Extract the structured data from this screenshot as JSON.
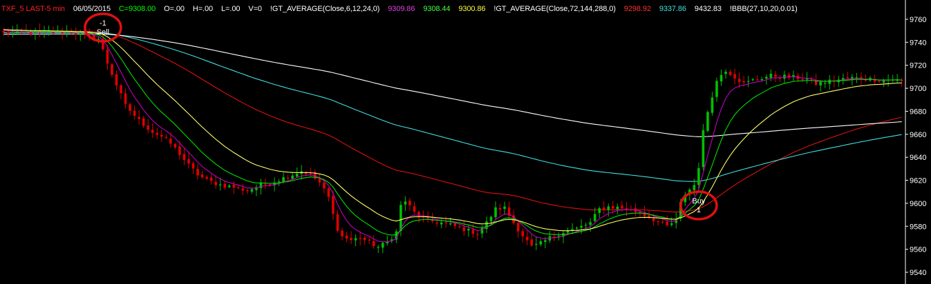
{
  "header": {
    "symbol": "TXF_5 LAST-5 min",
    "date": "06/05/2015",
    "close": "C=9308.00",
    "open": "O=.00",
    "high": "H=.00",
    "low": "L=.00",
    "volume": "V=0",
    "avg1_label": "!GT_AVERAGE(Close,6,12,24,0)",
    "avg1_v1": "9309.86",
    "avg1_v2": "9308.44",
    "avg1_v3": "9300.86",
    "avg2_label": "!GT_AVERAGE(Close,72,144,288,0)",
    "avg2_v1": "9298.92",
    "avg2_v2": "9337.86",
    "avg2_v3": "9432.83",
    "bbb_label": "!BBB(27,10,20,0.01)"
  },
  "signals": {
    "sell_qty": "-1",
    "sell_label": "Sell",
    "buy_label": "Buy",
    "buy_qty": "1"
  },
  "colors": {
    "background": "#000000",
    "up_candle": "#00c000",
    "down_candle": "#e00000",
    "avg6": "#c000c0",
    "avg12": "#00e000",
    "avg24": "#ffff66",
    "avg72": "#e01010",
    "avg144": "#40e0e0",
    "avg288": "#ffffff",
    "header_symbol": "#ff2020",
    "header_close": "#00ff00",
    "header_v1": "#e040e0",
    "header_v2": "#40ff40",
    "header_v3": "#ffff40",
    "header_avg2_v1": "#ff3030",
    "header_avg2_v2": "#40e0e0",
    "signal_circle": "#e01010"
  },
  "chart_data": {
    "type": "candlestick",
    "interval": "5 min",
    "ylim": [
      9535,
      9770
    ],
    "y_ticks": [
      9540,
      9560,
      9580,
      9600,
      9620,
      9640,
      9660,
      9680,
      9700,
      9720,
      9740,
      9760
    ],
    "bars": 200,
    "close_path": [
      [
        0,
        9748
      ],
      [
        15,
        9749
      ],
      [
        18,
        9746
      ],
      [
        21,
        9743
      ],
      [
        22,
        9733
      ],
      [
        23,
        9722
      ],
      [
        25,
        9703
      ],
      [
        27,
        9685
      ],
      [
        30,
        9672
      ],
      [
        33,
        9662
      ],
      [
        35,
        9658
      ],
      [
        37,
        9652
      ],
      [
        39,
        9643
      ],
      [
        41,
        9633
      ],
      [
        43,
        9625
      ],
      [
        45,
        9620
      ],
      [
        48,
        9616
      ],
      [
        51,
        9614
      ],
      [
        54,
        9611
      ],
      [
        57,
        9616
      ],
      [
        60,
        9619
      ],
      [
        62,
        9622
      ],
      [
        64,
        9625
      ],
      [
        66,
        9628
      ],
      [
        68,
        9625
      ],
      [
        70,
        9618
      ],
      [
        72,
        9605
      ],
      [
        73,
        9590
      ],
      [
        74,
        9578
      ],
      [
        75,
        9571
      ],
      [
        77,
        9568
      ],
      [
        79,
        9570
      ],
      [
        81,
        9566
      ],
      [
        83,
        9562
      ],
      [
        85,
        9566
      ],
      [
        87,
        9575
      ],
      [
        88,
        9598
      ],
      [
        89,
        9602
      ],
      [
        91,
        9592
      ],
      [
        94,
        9585
      ],
      [
        97,
        9583
      ],
      [
        100,
        9580
      ],
      [
        103,
        9576
      ],
      [
        105,
        9574
      ],
      [
        107,
        9583
      ],
      [
        109,
        9595
      ],
      [
        111,
        9596
      ],
      [
        113,
        9583
      ],
      [
        115,
        9572
      ],
      [
        117,
        9562
      ],
      [
        119,
        9565
      ],
      [
        121,
        9570
      ],
      [
        124,
        9575
      ],
      [
        127,
        9578
      ],
      [
        130,
        9583
      ],
      [
        132,
        9595
      ],
      [
        134,
        9597
      ],
      [
        137,
        9596
      ],
      [
        141,
        9592
      ],
      [
        143,
        9588
      ],
      [
        145,
        9584
      ],
      [
        147,
        9580
      ],
      [
        149,
        9585
      ],
      [
        150,
        9600
      ],
      [
        151,
        9608
      ],
      [
        152,
        9612
      ],
      [
        153,
        9616
      ],
      [
        154,
        9632
      ],
      [
        155,
        9662
      ],
      [
        156,
        9680
      ],
      [
        157,
        9694
      ],
      [
        158,
        9706
      ],
      [
        159,
        9712
      ],
      [
        160,
        9716
      ],
      [
        162,
        9710
      ],
      [
        164,
        9704
      ],
      [
        166,
        9707
      ],
      [
        170,
        9711
      ],
      [
        174,
        9710
      ],
      [
        178,
        9708
      ],
      [
        180,
        9704
      ],
      [
        184,
        9707
      ],
      [
        188,
        9709
      ],
      [
        192,
        9708
      ],
      [
        195,
        9707
      ],
      [
        197,
        9708
      ],
      [
        199,
        9706
      ]
    ],
    "moving_averages": [
      {
        "period": 6,
        "color": "#c000c0"
      },
      {
        "period": 12,
        "color": "#00e000"
      },
      {
        "period": 24,
        "color": "#ffff66"
      },
      {
        "period": 72,
        "color": "#e01010"
      },
      {
        "period": 144,
        "color": "#40e0e0"
      },
      {
        "period": 288,
        "color": "#ffffff"
      }
    ],
    "signals": [
      {
        "type": "sell",
        "bar": 22,
        "price": 9748,
        "qty": -1
      },
      {
        "type": "buy",
        "bar": 154,
        "price": 9603,
        "qty": 1
      }
    ]
  }
}
